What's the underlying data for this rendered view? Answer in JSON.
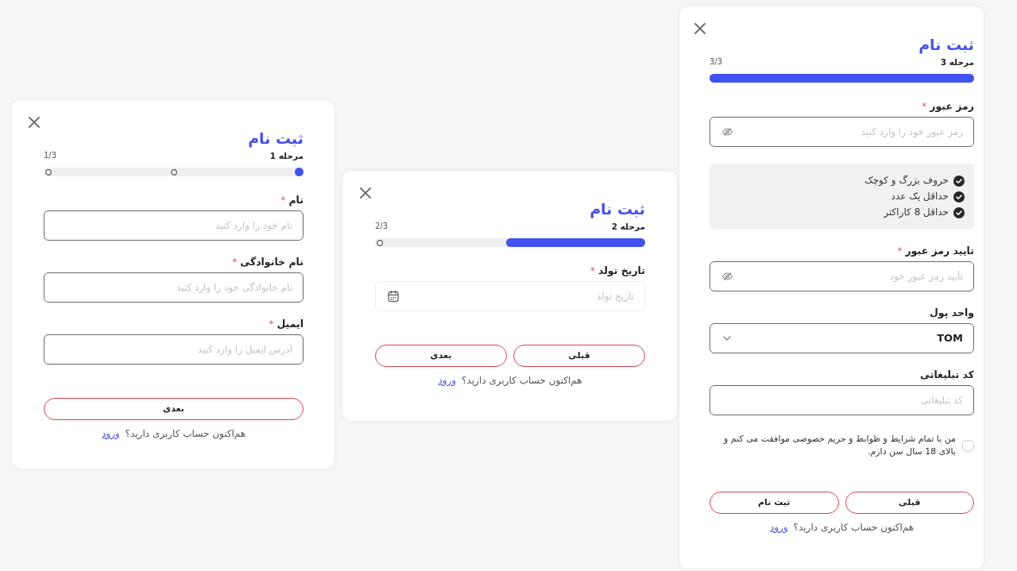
{
  "cards": [
    {
      "title": "ثبت نام",
      "step_label": "مرحله 1",
      "step_counter": "1/3",
      "progress": {
        "level": 0
      },
      "items": [
        {
          "kind": "text",
          "label": "نام",
          "required_mark": "*",
          "placeholder": "نام خود را وارد کنید"
        },
        {
          "kind": "text",
          "label": "نام خانوادگی",
          "required_mark": "*",
          "placeholder": "نام خانوادگی خود را وارد کنید"
        },
        {
          "kind": "text",
          "label": "ایمیل",
          "required_mark": "*",
          "placeholder": "آدرس ایمیل را وارد کنید"
        }
      ],
      "buttons": [
        "بعدی"
      ],
      "footer": {
        "text": "هم‌اکنون حساب کاربری دارید؟",
        "link": "ورود"
      }
    },
    {
      "title": "ثبت نام",
      "step_label": "مرحله 2",
      "step_counter": "2/3",
      "progress": {
        "level": 0.5
      },
      "items": [
        {
          "kind": "date",
          "label": "تاریخ تولد",
          "required_mark": "*",
          "placeholder": "تاریخ تولد"
        }
      ],
      "buttons": [
        "قبلی",
        "بعدی"
      ],
      "footer": {
        "text": "هم‌اکنون حساب کاربری دارید؟",
        "link": "ورود"
      }
    },
    {
      "title": "ثبت نام",
      "step_label": "مرحله 3",
      "step_counter": "3/3",
      "progress": {
        "level": 1
      },
      "items": [
        {
          "kind": "password",
          "label": "رمز عبور",
          "required_mark": "*",
          "placeholder": "رمز عبور خود را وارد کنید"
        },
        {
          "kind": "rules",
          "rules": [
            {
              "text": "حروف بزرگ و کوچک",
              "met": true
            },
            {
              "text": "حداقل یک عدد",
              "met": true
            },
            {
              "text": "حداقل 8 کاراکتر",
              "met": true
            }
          ]
        },
        {
          "kind": "password",
          "label": "تایید رمز عبور",
          "required_mark": "*",
          "placeholder": "تأیید رمز عبور خود"
        },
        {
          "kind": "select",
          "label": "واحد پول",
          "value": "TOM"
        },
        {
          "kind": "text",
          "label": "کد تبلیغاتی",
          "placeholder": "کد تبلیغاتی"
        },
        {
          "kind": "agreement",
          "text": "من با تمام شرایط و ظوابط و حریم خصوصی موافقت می کنم و بالای 18 سال سن دارم.",
          "checked": false
        }
      ],
      "buttons": [
        "قبلی",
        "ثبت نام"
      ],
      "footer": {
        "text": "هم‌اکنون حساب کاربری دارید؟",
        "link": "ورود"
      }
    }
  ]
}
